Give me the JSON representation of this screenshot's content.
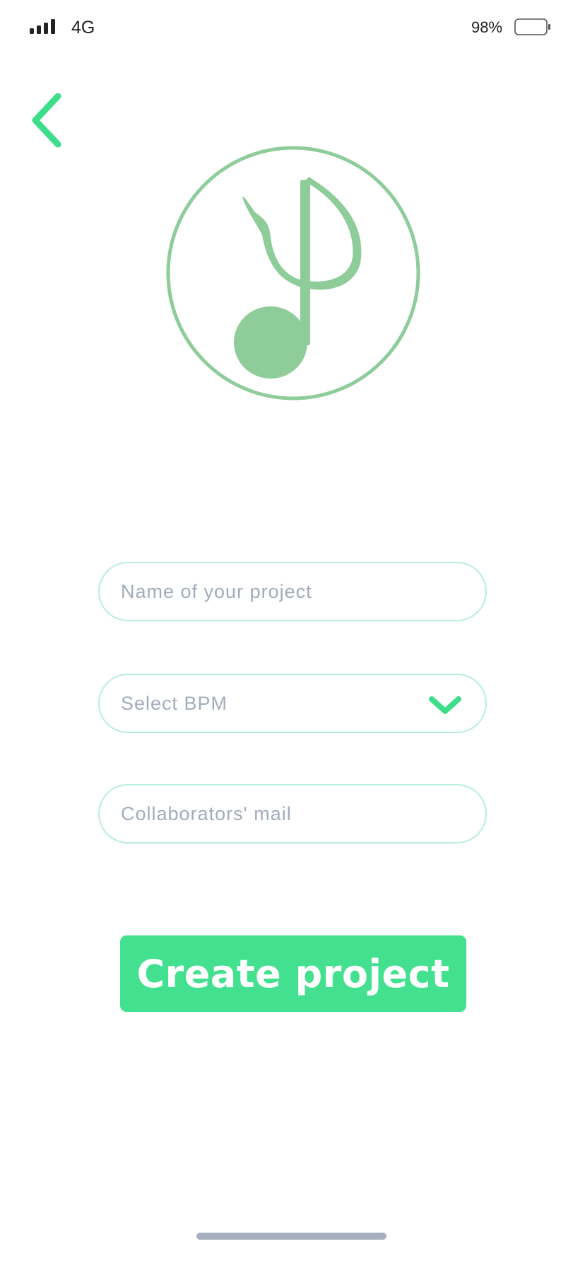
{
  "status_bar": {
    "network": "4G",
    "battery_percent": "98%",
    "battery_level": 0.98,
    "signal_icon": "signal-bars-icon",
    "battery_icon": "battery-icon"
  },
  "nav": {
    "back_icon": "chevron-left-icon"
  },
  "logo": {
    "icon": "music-note-icon",
    "color": "#8ecc99"
  },
  "form": {
    "project_name": {
      "placeholder": "Name of your project",
      "value": ""
    },
    "bpm": {
      "placeholder": "Select BPM",
      "icon": "chevron-down-icon"
    },
    "collaborators": {
      "placeholder": "Collaborators' mail",
      "value": ""
    }
  },
  "actions": {
    "create_label": "Create project"
  },
  "colors": {
    "accent": "#42e08f",
    "field_border": "#b6f0d8",
    "placeholder": "#a2acbd",
    "logo": "#8ecc99"
  }
}
